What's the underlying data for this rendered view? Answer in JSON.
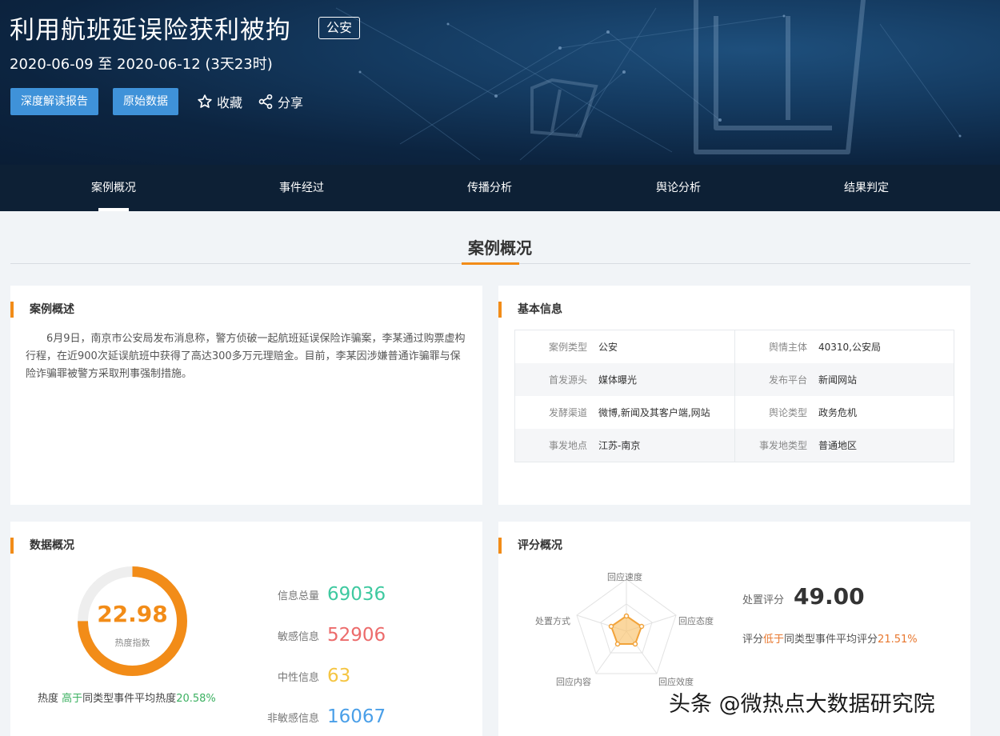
{
  "header": {
    "title": "利用航班延误险获利被拘",
    "tag": "公安",
    "date_range": "2020-06-09 至 2020-06-12 (3天23时)",
    "btn_report": "深度解读报告",
    "btn_raw": "原始数据",
    "favorite": "收藏",
    "share": "分享"
  },
  "nav": {
    "tabs": [
      "案例概况",
      "事件经过",
      "传播分析",
      "舆论分析",
      "结果判定"
    ],
    "active": 0
  },
  "section_title": "案例概况",
  "summary": {
    "heading": "案例概述",
    "text": "6月9日，南京市公安局发布消息称，警方侦破一起航班延误保险诈骗案，李某通过购票虚构行程，在近900次延误航班中获得了高达300多万元理赔金。目前，李某因涉嫌普通诈骗罪与保险诈骗罪被警方采取刑事强制措施。"
  },
  "basic": {
    "heading": "基本信息",
    "rows": [
      [
        {
          "k": "案例类型",
          "v": "公安"
        },
        {
          "k": "舆情主体",
          "v": "40310,公安局"
        }
      ],
      [
        {
          "k": "首发源头",
          "v": "媒体曝光"
        },
        {
          "k": "发布平台",
          "v": "新闻网站"
        }
      ],
      [
        {
          "k": "发酵渠道",
          "v": "微博,新闻及其客户端,网站"
        },
        {
          "k": "舆论类型",
          "v": "政务危机"
        }
      ],
      [
        {
          "k": "事发地点",
          "v": "江苏-南京"
        },
        {
          "k": "事发地类型",
          "v": "普通地区"
        }
      ]
    ]
  },
  "data_overview": {
    "heading": "数据概况",
    "heat_index": "22.98",
    "heat_label": "热度指数",
    "heat_ratio": 0.75,
    "heat_prefix": "热度",
    "heat_cmp": "高于",
    "heat_mid": "同类型事件平均热度",
    "heat_pct": "20.58%",
    "stats": [
      {
        "label": "信息总量",
        "value": "69036",
        "color": "#3ec9a0"
      },
      {
        "label": "敏感信息",
        "value": "52906",
        "color": "#ec6b6b"
      },
      {
        "label": "中性信息",
        "value": "63",
        "color": "#f5c542"
      },
      {
        "label": "非敏感信息",
        "value": "16067",
        "color": "#4a9fe8"
      }
    ]
  },
  "score": {
    "heading": "评分概况",
    "axes": [
      "回应速度",
      "回应态度",
      "回应效度",
      "回应内容",
      "处置方式"
    ],
    "label": "处置评分",
    "value": "49.00",
    "cmp_prefix": "评分",
    "cmp_word": "低于",
    "cmp_mid": "同类型事件平均评分",
    "cmp_pct": "21.51%"
  },
  "watermark": "头条 @微热点大数据研究院",
  "colors": {
    "accent": "#f28c18",
    "button": "#3f92d9",
    "nav_bg": "#0d2035"
  }
}
